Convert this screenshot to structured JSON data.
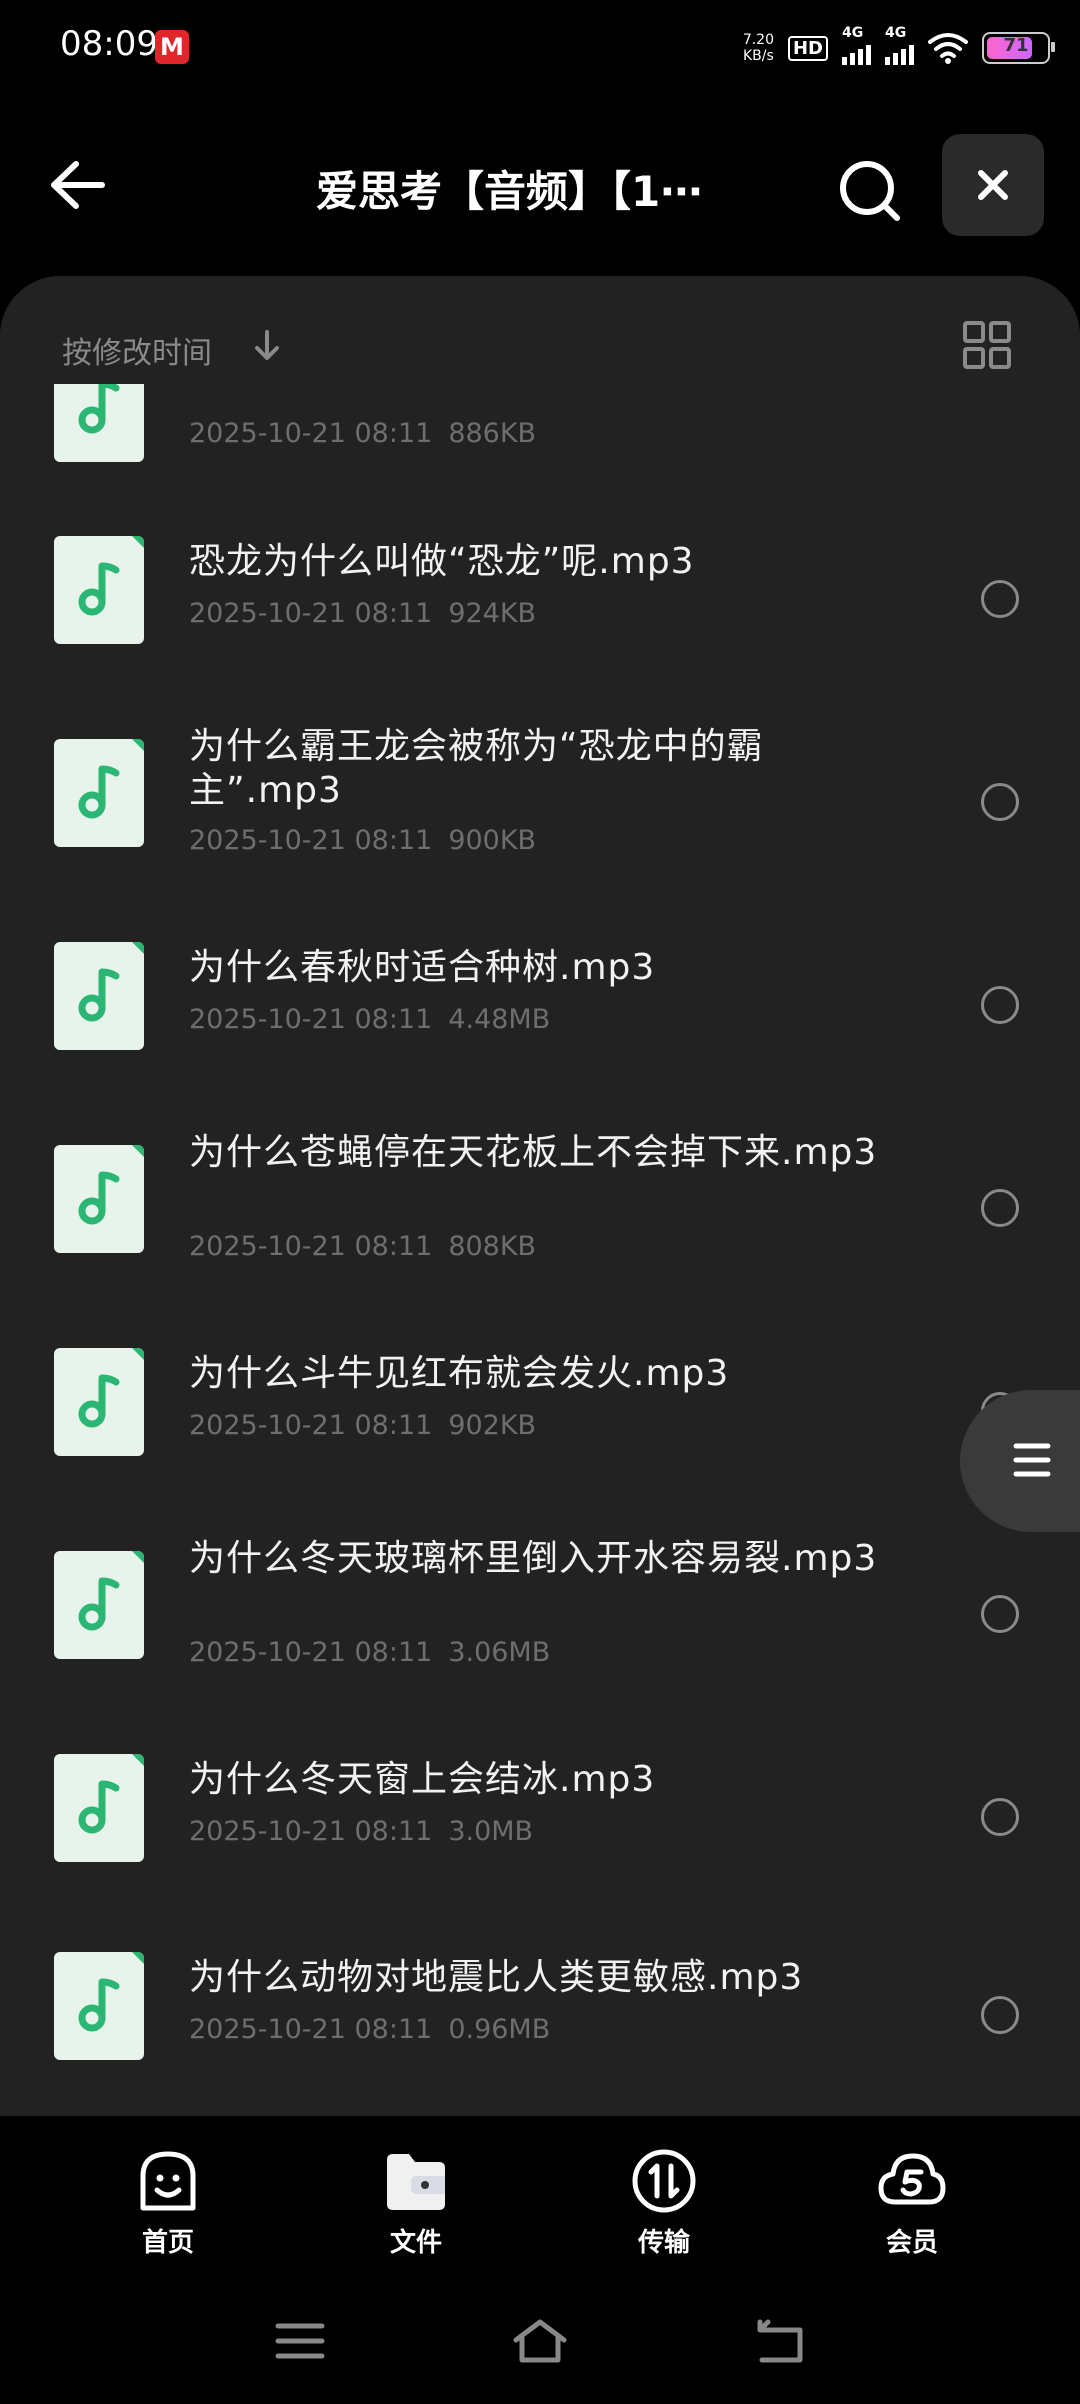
{
  "status_bar": {
    "time": "08:09",
    "app_icon_letter": "M",
    "net_speed_value": "7.20",
    "net_speed_unit": "KB/s",
    "hd_label": "HD",
    "sim1_label": "4G",
    "sim2_label": "4G",
    "battery": "71"
  },
  "header": {
    "title": "爱思考【音频】【1⋯"
  },
  "sort": {
    "label": "按修改时间"
  },
  "files": [
    {
      "name": "",
      "date": "2025-10-21 08:11",
      "size": "886KB"
    },
    {
      "name": "恐龙为什么叫做“恐龙”呢.mp3",
      "date": "2025-10-21 08:11",
      "size": "924KB"
    },
    {
      "name": "为什么霸王龙会被称为“恐龙中的霸主”.mp3",
      "date": "2025-10-21 08:11",
      "size": "900KB"
    },
    {
      "name": "为什么春秋时适合种树.mp3",
      "date": "2025-10-21 08:11",
      "size": "4.48MB"
    },
    {
      "name": "为什么苍蝇停在天花板上不会掉下来.mp3",
      "date": "2025-10-21 08:11",
      "size": "808KB"
    },
    {
      "name": "为什么斗牛见红布就会发火.mp3",
      "date": "2025-10-21 08:11",
      "size": "902KB"
    },
    {
      "name": "为什么冬天玻璃杯里倒入开水容易裂.mp3",
      "date": "2025-10-21 08:11",
      "size": "3.06MB"
    },
    {
      "name": "为什么冬天窗上会结冰.mp3",
      "date": "2025-10-21 08:11",
      "size": "3.0MB"
    },
    {
      "name": "为什么动物对地震比人类更敏感.mp3",
      "date": "2025-10-21 08:11",
      "size": "0.96MB"
    }
  ],
  "tabs": [
    {
      "label": "首页",
      "icon": "home-face-icon"
    },
    {
      "label": "文件",
      "icon": "folder-icon"
    },
    {
      "label": "传输",
      "icon": "transfer-icon"
    },
    {
      "label": "会员",
      "icon": "cloud-member-icon"
    }
  ]
}
